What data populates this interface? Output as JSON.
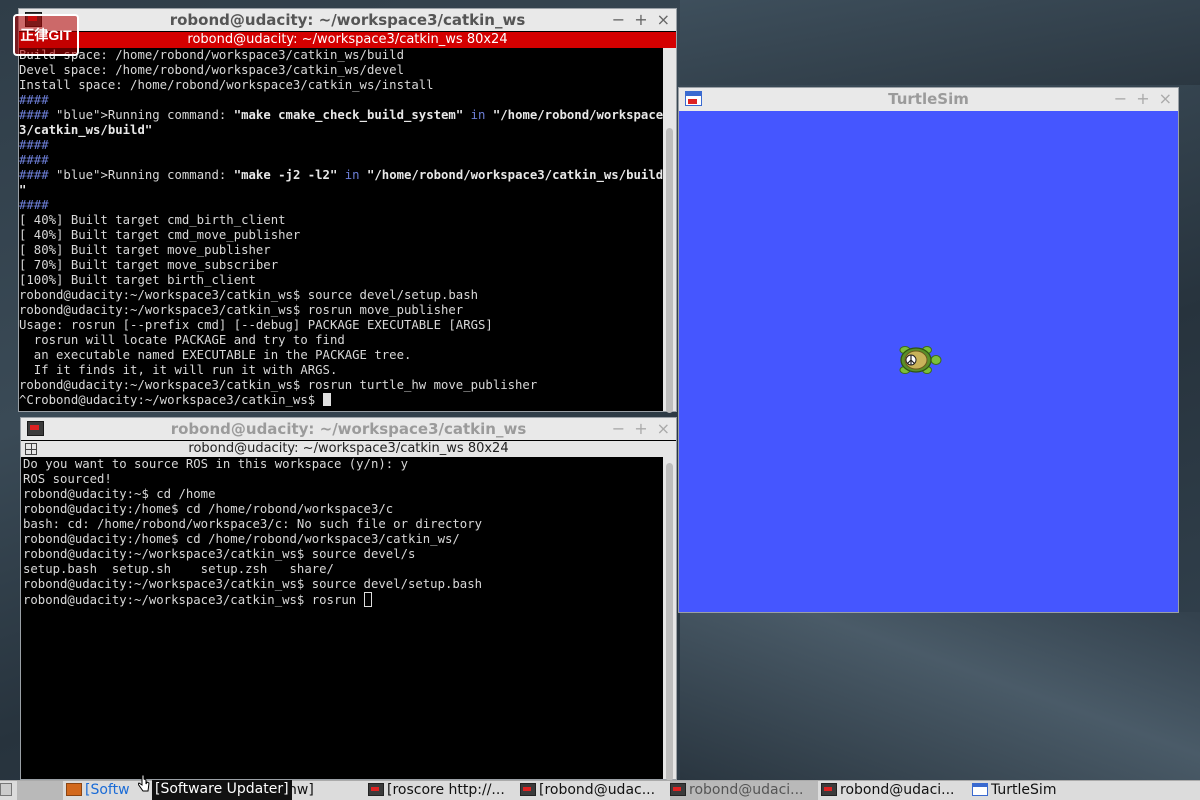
{
  "desktop": {
    "logo_text": "正律GIT"
  },
  "term1": {
    "title": "robond@udacity: ~/workspace3/catkin_ws",
    "subtitle": "robond@udacity: ~/workspace3/catkin_ws 80x24",
    "lines": [
      "Build space: /home/robond/workspace3/catkin_ws/build",
      "Devel space: /home/robond/workspace3/catkin_ws/devel",
      "Install space: /home/robond/workspace3/catkin_ws/install",
      "####",
      "#### Running command: \"make cmake_check_build_system\" in \"/home/robond/workspace",
      "3/catkin_ws/build\"",
      "####",
      "####",
      "#### Running command: \"make -j2 -l2\" in \"/home/robond/workspace3/catkin_ws/build",
      "\"",
      "####",
      "[ 40%] Built target cmd_birth_client",
      "[ 40%] Built target cmd_move_publisher",
      "[ 80%] Built target move_publisher",
      "[ 70%] Built target move_subscriber",
      "[100%] Built target birth_client",
      "robond@udacity:~/workspace3/catkin_ws$ source devel/setup.bash",
      "robond@udacity:~/workspace3/catkin_ws$ rosrun move_publisher",
      "Usage: rosrun [--prefix cmd] [--debug] PACKAGE EXECUTABLE [ARGS]",
      "  rosrun will locate PACKAGE and try to find",
      "  an executable named EXECUTABLE in the PACKAGE tree.",
      "  If it finds it, it will run it with ARGS.",
      "robond@udacity:~/workspace3/catkin_ws$ rosrun turtle_hw move_publisher",
      "^Crobond@udacity:~/workspace3/catkin_ws$ "
    ]
  },
  "term2": {
    "title": "robond@udacity: ~/workspace3/catkin_ws",
    "subtitle": "robond@udacity: ~/workspace3/catkin_ws 80x24",
    "lines": [
      "Do you want to source ROS in this workspace (y/n): y",
      "ROS sourced!",
      "robond@udacity:~$ cd /home",
      "robond@udacity:/home$ cd /home/robond/workspace3/c",
      "bash: cd: /home/robond/workspace3/c: No such file or directory",
      "robond@udacity:/home$ cd /home/robond/workspace3/catkin_ws/",
      "robond@udacity:~/workspace3/catkin_ws$ source devel/s",
      "setup.bash  setup.sh    setup.zsh   share/",
      "robond@udacity:~/workspace3/catkin_ws$ source devel/setup.bash",
      "robond@udacity:~/workspace3/catkin_ws$ rosrun "
    ]
  },
  "turtlesim": {
    "title": "TurtleSim",
    "bg_color": "#4556ff",
    "turtle_x": 0.388,
    "turtle_y": 0.498
  },
  "window_controls": {
    "minimize": "−",
    "maximize": "+",
    "close": "×"
  },
  "taskbar": {
    "items": [
      {
        "label": "[Softw",
        "icon": "package-icon"
      },
      {
        "label": "hw]",
        "icon": "terminal-icon"
      },
      {
        "label": "[roscore http://...",
        "icon": "terminal-icon"
      },
      {
        "label": "[robond@udac...",
        "icon": "terminal-icon"
      },
      {
        "label": "robond@udaci...",
        "icon": "terminal-icon"
      },
      {
        "label": "robond@udaci...",
        "icon": "terminal-icon"
      },
      {
        "label": "TurtleSim",
        "icon": "turtlesim-icon"
      }
    ],
    "tooltip": "[Software Updater]"
  }
}
